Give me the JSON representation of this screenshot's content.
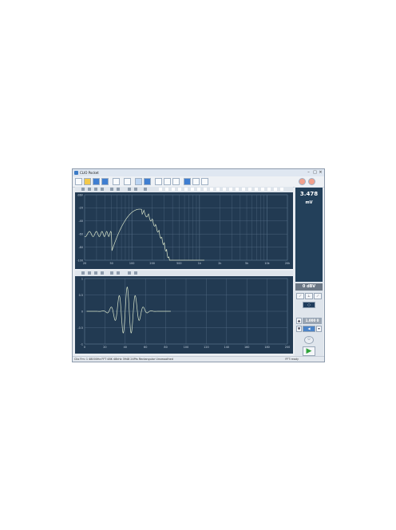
{
  "window": {
    "title": "CLIO Pocket",
    "controls": [
      "–",
      "□",
      "×"
    ]
  },
  "toolbar": {
    "icons": [
      "menu-icon",
      "open-folder-icon",
      "save-icon",
      "save-as-icon",
      "print-icon",
      "check-icon",
      "marker-icon",
      "color-icon",
      "window-icon",
      "split-icon",
      "layout-icon",
      "chart-icon",
      "note-icon",
      "settings-icon"
    ]
  },
  "sidebar": {
    "level_value": "3.478",
    "level_unit": "mV",
    "ref_label": "0 dBV",
    "gain_value": "1.000 0"
  },
  "status": {
    "left": "Clio Fm: 1 48000Hz   FFT  48K  48kHz  3948  24Pts  Rectangular  Unsmoothed",
    "right": "FFT ready"
  },
  "top_panel": {
    "y_ticks": [
      "dBV",
      "-20",
      "-40",
      "-60",
      "-80",
      "-100"
    ],
    "x_ticks": [
      "20",
      "50",
      "100",
      "200",
      "500",
      "1k",
      "2k",
      "5k",
      "10k",
      "20k"
    ]
  },
  "bottom_panel": {
    "y_ticks": [
      "1",
      "0.5",
      "0",
      "-0.5",
      "-1"
    ],
    "x_ticks": [
      "0",
      "20",
      "40",
      "60",
      "80",
      "100",
      "120",
      "140",
      "160",
      "180",
      "200"
    ]
  },
  "colors": {
    "plot_bg": "#223a52",
    "grid": "#566f88",
    "trace": "#d8e4c9",
    "accent": "#3f7ed1",
    "play": "#2fa33a"
  }
}
